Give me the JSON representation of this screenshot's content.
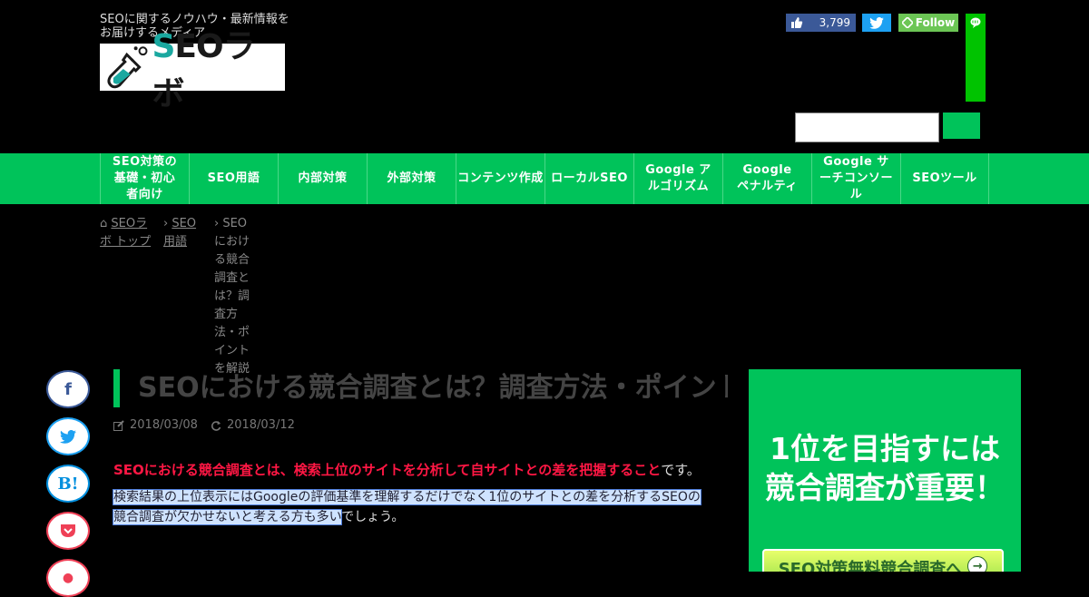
{
  "header": {
    "tagline": "SEOに関するノウハウ・最新情報をお届けするメディア",
    "logo_text_s": "S",
    "logo_text_eo": "EO",
    "logo_text_ra": "ラボ",
    "fb_count": "3,799",
    "feedly_label": "Follow",
    "search_placeholder": ""
  },
  "nav": {
    "items": [
      {
        "label": "SEO対策の基礎・初心者向け"
      },
      {
        "label": "SEO用語"
      },
      {
        "label": "内部対策"
      },
      {
        "label": "外部対策"
      },
      {
        "label": "コンテンツ作成"
      },
      {
        "label": "ローカルSEO"
      },
      {
        "label": "Google アルゴリズム"
      },
      {
        "label": "Google ペナルティ"
      },
      {
        "label": "Google サーチコンソール"
      },
      {
        "label": "SEOツール"
      }
    ]
  },
  "breadcrumb": {
    "home": "SEOラボ トップ",
    "category": "SEO用語",
    "current": "SEOにおける競合調査とは？調査方法・ポイントを解説"
  },
  "article": {
    "title": "SEOにおける競合調査とは？調査方法・ポイントを解説",
    "published": "2018/03/08",
    "updated": "2018/03/12",
    "lead": "SEOにおける競合調査とは、検索上位のサイトを分析して自サイトとの差を把握すること",
    "lead_tail": "です。",
    "body_hl": "検索結果の上位表示にはGoogleの評価基準を理解するだけでなく1位のサイトとの差を分析するSEOの競合調査が欠かせないと考える方も多い",
    "body_tail": "でしょう。"
  },
  "social": {
    "facebook_icon": "f",
    "hatena_icon": "B!"
  },
  "ad": {
    "line1": "1位を目指すには",
    "line2": "競合調査が重要！",
    "button": "SEO対策無料競合調査へ"
  },
  "colors": {
    "accent": "#00c35a",
    "lead_red": "#ff1744"
  }
}
